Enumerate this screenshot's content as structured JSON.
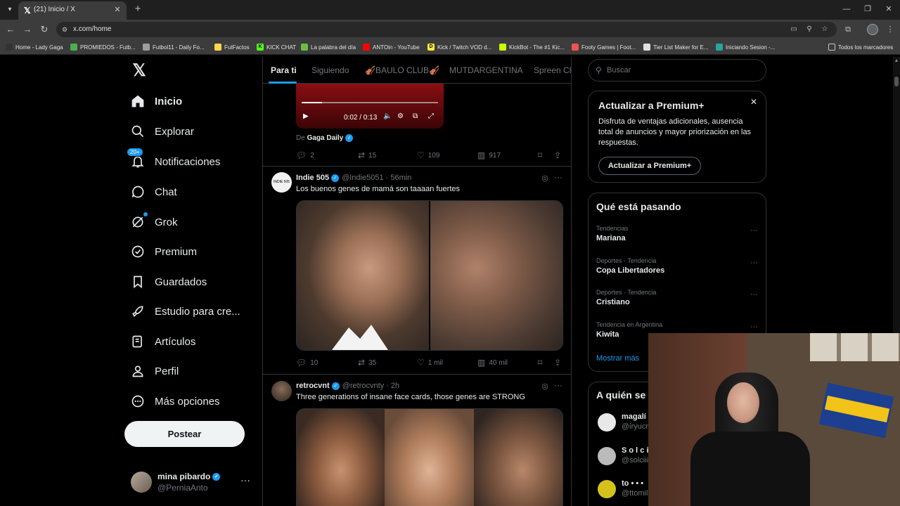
{
  "browser": {
    "tab_title": "(21) Inicio / X",
    "url": "x.com/home",
    "bookmarks": [
      {
        "label": "Home - Lady Gaga",
        "color": "#333333"
      },
      {
        "label": "PROMIEDOS - Futb...",
        "color": "#4caf50"
      },
      {
        "label": "Futbol11 - Daily Fo...",
        "color": "#9e9e9e"
      },
      {
        "label": "FutFactos",
        "color": "#ffd54f"
      },
      {
        "label": "KICK CHAT",
        "color": "#53fc18"
      },
      {
        "label": "La palabra del día",
        "color": "#6abe45"
      },
      {
        "label": "ANTOin - YouTube",
        "color": "#ff0000"
      },
      {
        "label": "Kick / Twitch VOD d...",
        "color": "#ffeb3b"
      },
      {
        "label": "KickBot - The #1 Kic...",
        "color": "#c6ff00"
      },
      {
        "label": "Footy Games | Foot...",
        "color": "#ef5350"
      },
      {
        "label": "Tier List Maker for E...",
        "color": "#e0e0e0"
      },
      {
        "label": "Iniciando Sesion -...",
        "color": "#26a69a"
      }
    ],
    "all_bookmarks": "Todos los marcadores"
  },
  "nav": {
    "items": [
      {
        "label": "Inicio",
        "icon": "home-icon"
      },
      {
        "label": "Explorar",
        "icon": "search-icon"
      },
      {
        "label": "Notificaciones",
        "icon": "bell-icon",
        "badge": "20+"
      },
      {
        "label": "Chat",
        "icon": "chat-icon"
      },
      {
        "label": "Grok",
        "icon": "grok-icon"
      },
      {
        "label": "Premium",
        "icon": "premium-icon"
      },
      {
        "label": "Guardados",
        "icon": "bookmark-icon"
      },
      {
        "label": "Estudio para cre...",
        "icon": "rocket-icon"
      },
      {
        "label": "Artículos",
        "icon": "articles-icon"
      },
      {
        "label": "Perfil",
        "icon": "person-icon"
      },
      {
        "label": "Más opciones",
        "icon": "more-circle-icon"
      }
    ],
    "post_button": "Postear",
    "account": {
      "name": "mina pibardo",
      "handle": "@PerniaAnto"
    }
  },
  "timeline": {
    "tabs": [
      "Para ti",
      "Siguiendo",
      "🎻BAULO CLUB🎻",
      "MUTDARGENTINA",
      "Spreen Cl"
    ],
    "video": {
      "time": "0:02 / 0:13",
      "progress": 0.15
    },
    "quote_source_prefix": "De",
    "quote_source_name": "Gaga Daily",
    "first_actions": {
      "replies": "2",
      "reposts": "15",
      "likes": "109",
      "views": "917"
    },
    "tweets": [
      {
        "name": "Indie 505",
        "handle": "@Indie5051 · 56min",
        "text": "Los buenos genes de mamá son taaaan fuertes",
        "avatar_text": "INDIE 505",
        "replies": "10",
        "reposts": "35",
        "likes": "1 mil",
        "views": "40 mil"
      },
      {
        "name": "retrocvnt",
        "handle": "@retrocvnty · 2h",
        "text": "Three generations of insane face cards, those genes are STRONG"
      }
    ]
  },
  "sidebar": {
    "search_placeholder": "Buscar",
    "premium": {
      "title": "Actualizar a Premium+",
      "description": "Disfruta de ventajas adicionales, ausencia total de anuncios y mayor priorización en las respuestas.",
      "button": "Actualizar a Premium+"
    },
    "trends_title": "Qué está pasando",
    "trends": [
      {
        "category": "Tendencias",
        "name": "Mariana"
      },
      {
        "category": "Deportes · Tendencia",
        "name": "Copa Libertadores"
      },
      {
        "category": "Deportes · Tendencia",
        "name": "Cristiano"
      },
      {
        "category": "Tendencia en Argentina",
        "name": "Kiwita"
      }
    ],
    "show_more": "Mostrar más",
    "who_title": "A quién se",
    "who": [
      {
        "name": "magalí",
        "handle": "@iryucr"
      },
      {
        "name": "S o l c i",
        "handle": "@solciii"
      },
      {
        "name": "to • • •",
        "handle": "@ttomil"
      }
    ]
  },
  "colors": {
    "accent": "#1d9bf0",
    "background": "#000000",
    "border": "#2f3336",
    "muted": "#71767b"
  }
}
